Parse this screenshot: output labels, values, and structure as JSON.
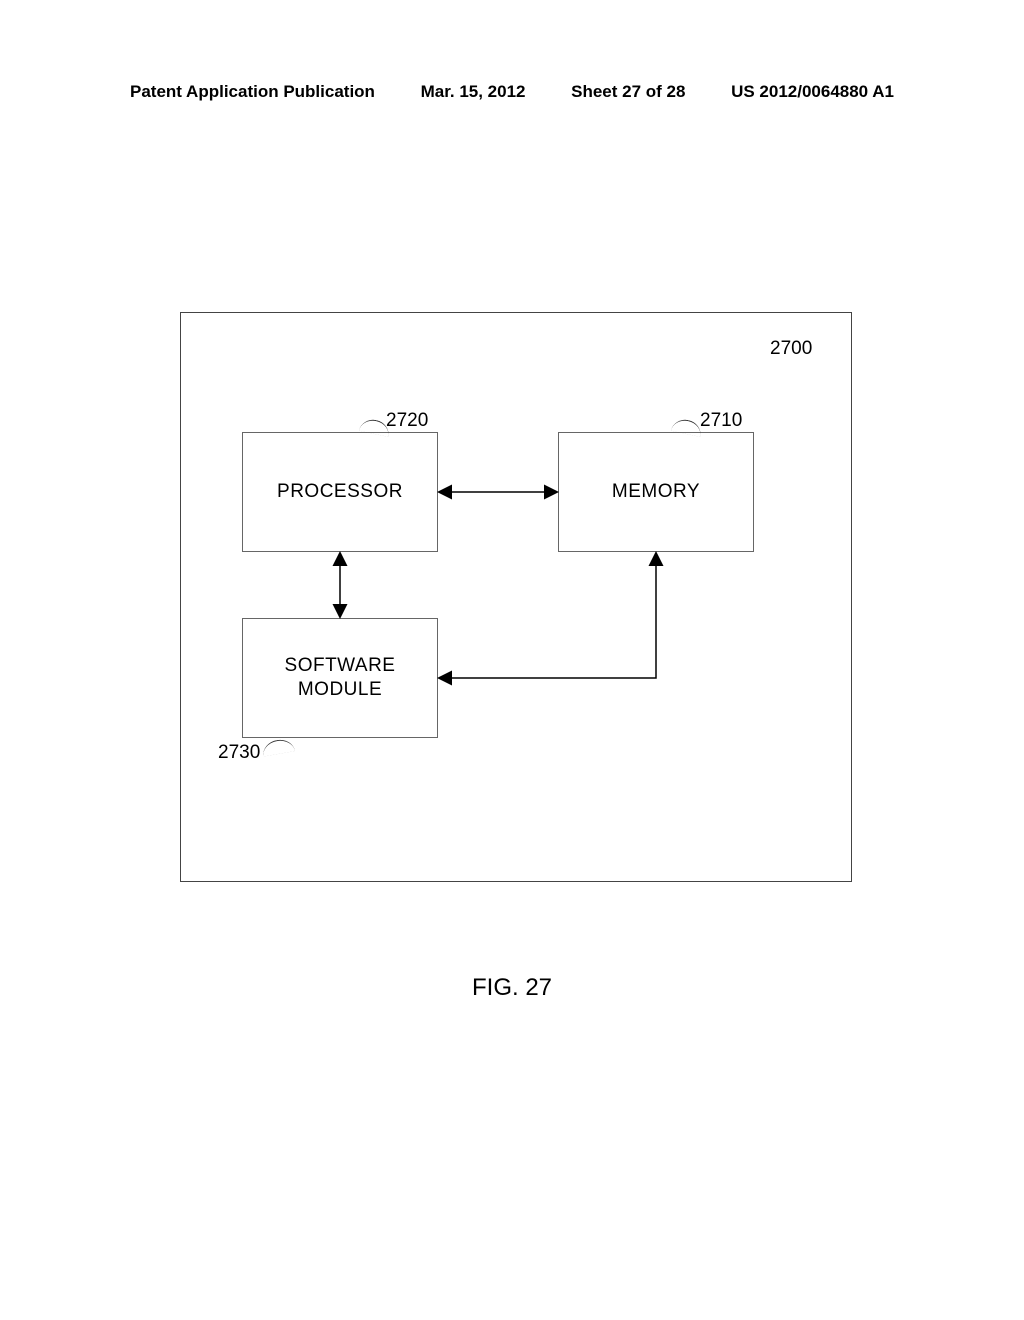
{
  "header": {
    "publication": "Patent Application Publication",
    "date": "Mar. 15, 2012",
    "sheet": "Sheet 27 of 28",
    "docnum": "US 2012/0064880 A1"
  },
  "labels": {
    "processor": "PROCESSOR",
    "memory": "MEMORY",
    "software": "SOFTWARE\nMODULE"
  },
  "refs": {
    "outer": "2700",
    "processor": "2720",
    "memory": "2710",
    "software": "2730"
  },
  "figure": "FIG. 27",
  "chart_data": {
    "type": "diagram",
    "title": "FIG. 27",
    "container": {
      "id": "2700"
    },
    "nodes": [
      {
        "id": "2720",
        "label": "PROCESSOR"
      },
      {
        "id": "2710",
        "label": "MEMORY"
      },
      {
        "id": "2730",
        "label": "SOFTWARE MODULE"
      }
    ],
    "edges": [
      {
        "from": "2720",
        "to": "2710",
        "direction": "bidirectional"
      },
      {
        "from": "2720",
        "to": "2730",
        "direction": "bidirectional"
      },
      {
        "from": "2710",
        "to": "2730",
        "direction": "unidirectional"
      }
    ]
  }
}
